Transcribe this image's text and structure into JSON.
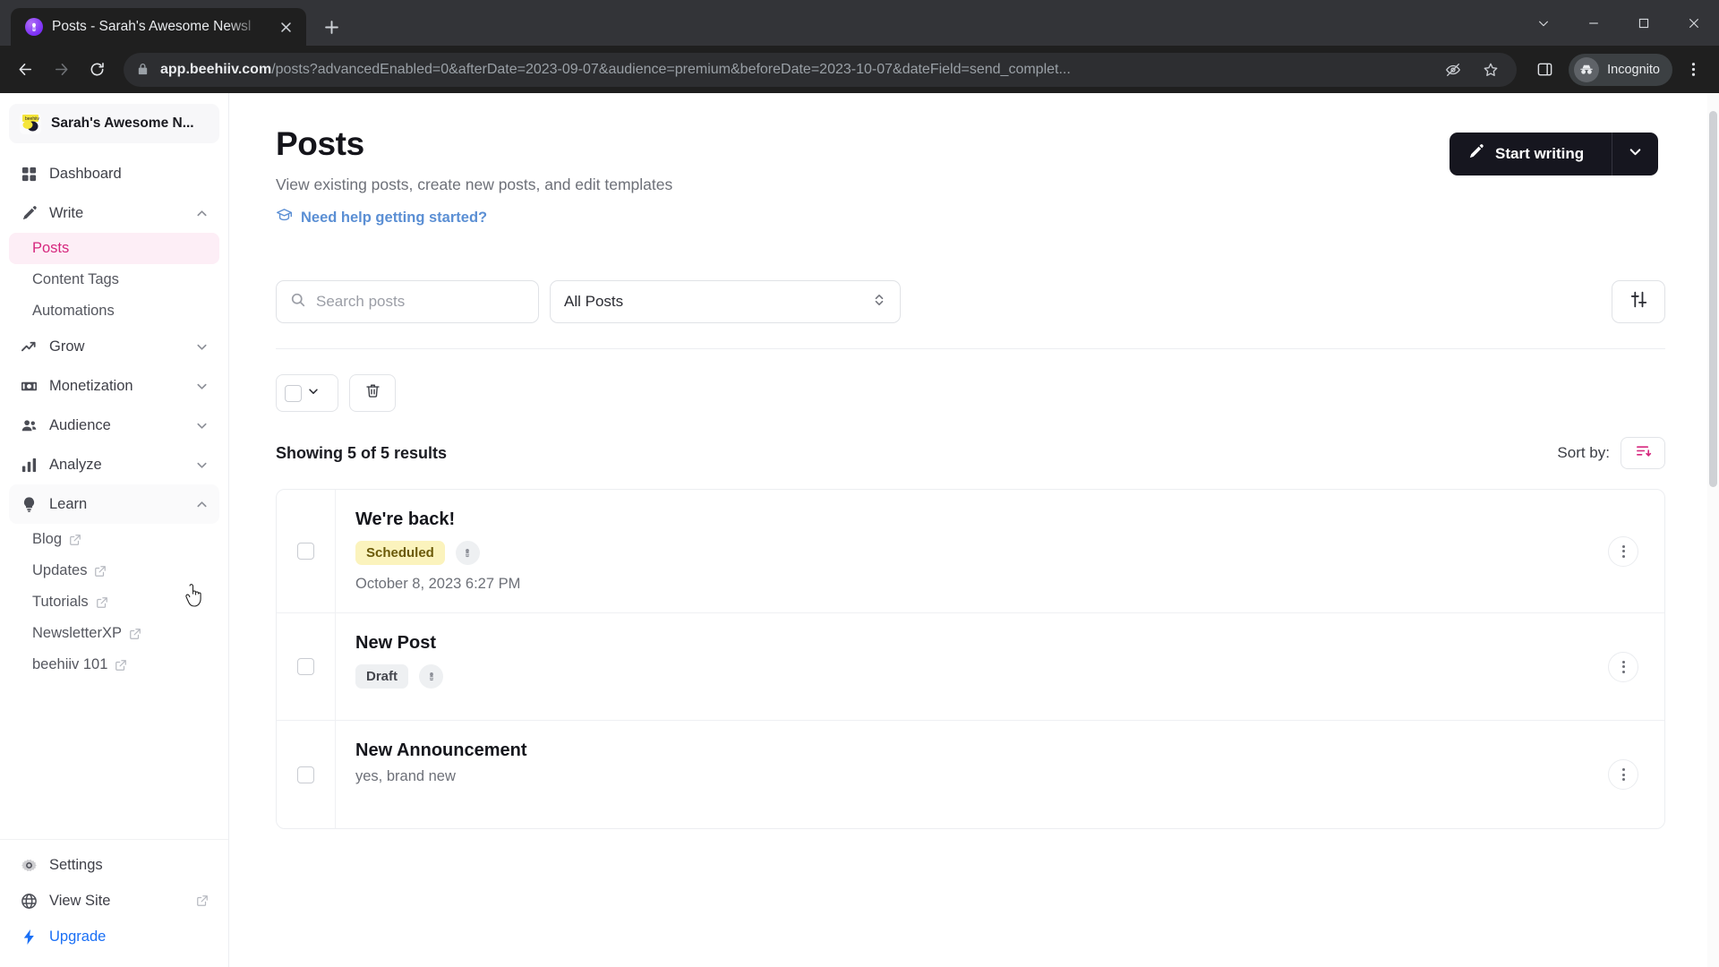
{
  "browser": {
    "tab": {
      "title": "Posts - Sarah's Awesome Newsl",
      "favicon": "beehiiv-icon",
      "close": "close-icon"
    },
    "new_tab_label": "new-tab-icon",
    "window_controls": [
      "minimize-to-tray-icon",
      "minimize-icon",
      "maximize-icon",
      "close-window-icon"
    ],
    "nav": {
      "back": "back-arrow-icon",
      "forward": "forward-arrow-icon",
      "reload": "reload-icon"
    },
    "omnibox": {
      "lock": "lock-icon",
      "url_domain": "app.beehiiv.com",
      "url_path": "/posts?advancedEnabled=0&afterDate=2023-09-07&audience=premium&beforeDate=2023-10-07&dateField=send_complet...",
      "tracking_protection": "tracking-protection-off-icon",
      "bookmark": "star-icon"
    },
    "side_panel": "side-panel-icon",
    "profile": {
      "label": "Incognito",
      "icon": "incognito-icon"
    },
    "menu": "three-dot-menu-icon"
  },
  "sidebar": {
    "publication": {
      "name": "Sarah's Awesome N...",
      "logo": "bee-logo-icon"
    },
    "items": [
      {
        "label": "Dashboard",
        "icon": "grid-icon",
        "expandable": false
      },
      {
        "label": "Write",
        "icon": "pencil-icon",
        "expandable": true,
        "chevron": "chevron-up-icon",
        "expanded": true
      },
      {
        "label": "Grow",
        "icon": "trending-up-icon",
        "expandable": true,
        "chevron": "chevron-down-icon",
        "expanded": false
      },
      {
        "label": "Monetization",
        "icon": "money-icon",
        "expandable": true,
        "chevron": "chevron-down-icon",
        "expanded": false
      },
      {
        "label": "Audience",
        "icon": "people-icon",
        "expandable": true,
        "chevron": "chevron-down-icon",
        "expanded": false
      },
      {
        "label": "Analyze",
        "icon": "bar-chart-icon",
        "expandable": true,
        "chevron": "chevron-down-icon",
        "expanded": false
      },
      {
        "label": "Learn",
        "icon": "lightbulb-icon",
        "expandable": true,
        "chevron": "chevron-up-icon",
        "expanded": true
      }
    ],
    "write_subitems": [
      {
        "label": "Posts",
        "selected": true
      },
      {
        "label": "Content Tags",
        "selected": false
      },
      {
        "label": "Automations",
        "selected": false
      }
    ],
    "learn_subitems": [
      {
        "label": "Blog",
        "external": true
      },
      {
        "label": "Updates",
        "external": true
      },
      {
        "label": "Tutorials",
        "external": true
      },
      {
        "label": "NewsletterXP",
        "external": true
      },
      {
        "label": "beehiiv 101",
        "external": true
      }
    ],
    "bottom_items": [
      {
        "label": "Settings",
        "icon": "gear-icon",
        "external": false,
        "accent": false
      },
      {
        "label": "View Site",
        "icon": "globe-icon",
        "external": true,
        "accent": false
      },
      {
        "label": "Upgrade",
        "icon": "lightning-icon",
        "external": false,
        "accent": true
      }
    ]
  },
  "main": {
    "title": "Posts",
    "subtitle": "View existing posts, create new posts, and edit templates",
    "help_link": "Need help getting started?",
    "help_icon": "graduation-cap-icon",
    "cta": {
      "label": "Start writing",
      "icon": "pencil-icon",
      "dropdown_icon": "chevron-down-icon"
    },
    "search": {
      "placeholder": "Search posts",
      "value": "",
      "icon": "search-icon"
    },
    "audience_select": {
      "value": "All Posts",
      "icon": "chevron-up-down-icon"
    },
    "filter_button": "sliders-icon",
    "bulk": {
      "checkbox": "bulk-select-checkbox",
      "dropdown_icon": "chevron-down-icon",
      "delete_icon": "trash-icon"
    },
    "results_text": "Showing 5 of 5 results",
    "sort": {
      "label": "Sort by:",
      "icon": "sort-descending-icon",
      "accent": "#d6277e"
    },
    "posts": [
      {
        "title": "We're back!",
        "description": "",
        "status": "Scheduled",
        "status_type": "scheduled",
        "platform_icon": "bee-icon",
        "date": "October 8, 2023 6:27 PM",
        "menu_icon": "kebab-menu-icon"
      },
      {
        "title": "New Post",
        "description": "",
        "status": "Draft",
        "status_type": "draft",
        "platform_icon": "bee-icon",
        "date": "",
        "menu_icon": "kebab-menu-icon"
      },
      {
        "title": "New Announcement",
        "description": "yes, brand new",
        "status": "",
        "status_type": "",
        "platform_icon": "",
        "date": "",
        "menu_icon": "kebab-menu-icon"
      }
    ]
  },
  "colors": {
    "accent_pink": "#d6277e",
    "accent_pink_bg": "#fdeef6",
    "cta_dark": "#16161f",
    "link_blue": "#5b8fd4",
    "upgrade_blue": "#1a6ff5",
    "scheduled_bg": "#fbf3bd",
    "draft_bg": "#eef0f2"
  }
}
